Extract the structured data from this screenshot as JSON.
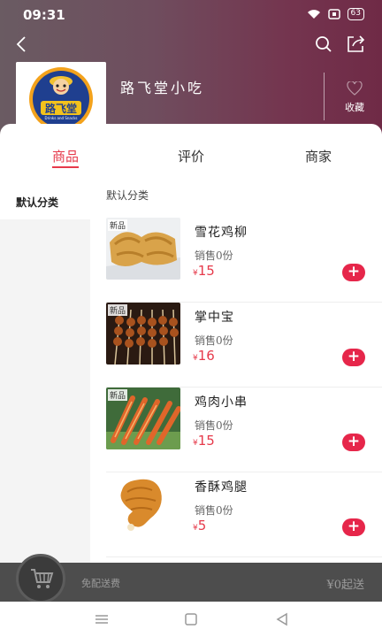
{
  "status_bar": {
    "time": "09:31",
    "battery": "63"
  },
  "shop": {
    "name": "路飞堂小吃",
    "logo_text": "路飞堂",
    "logo_subtext": "Drinks and Snacks",
    "favorite_label": "收藏"
  },
  "tabs": [
    {
      "label": "商品",
      "active": true
    },
    {
      "label": "评价",
      "active": false
    },
    {
      "label": "商家",
      "active": false
    }
  ],
  "sidebar": {
    "items": [
      {
        "label": "默认分类",
        "active": true
      }
    ]
  },
  "category": {
    "title": "默认分类"
  },
  "products": [
    {
      "name": "雪花鸡柳",
      "sales": "销售0份",
      "currency": "¥",
      "price": "15",
      "badge": "新品",
      "image": "chicken-strips"
    },
    {
      "name": "掌中宝",
      "sales": "销售0份",
      "currency": "¥",
      "price": "16",
      "badge": "新品",
      "image": "skewers"
    },
    {
      "name": "鸡肉小串",
      "sales": "销售0份",
      "currency": "¥",
      "price": "15",
      "badge": "新品",
      "image": "chicken-skewers"
    },
    {
      "name": "香酥鸡腿",
      "sales": "销售0份",
      "currency": "¥",
      "price": "5",
      "badge": "",
      "image": "fried-drumstick"
    }
  ],
  "add_button_label": "+",
  "cart": {
    "delivery_fee": "免配送费",
    "min_order": "¥0起送"
  },
  "colors": {
    "accent": "#e63a4b",
    "header_start": "#6a5b62",
    "header_end": "#6f2a46",
    "cart_bar": "#4d4d4d"
  }
}
